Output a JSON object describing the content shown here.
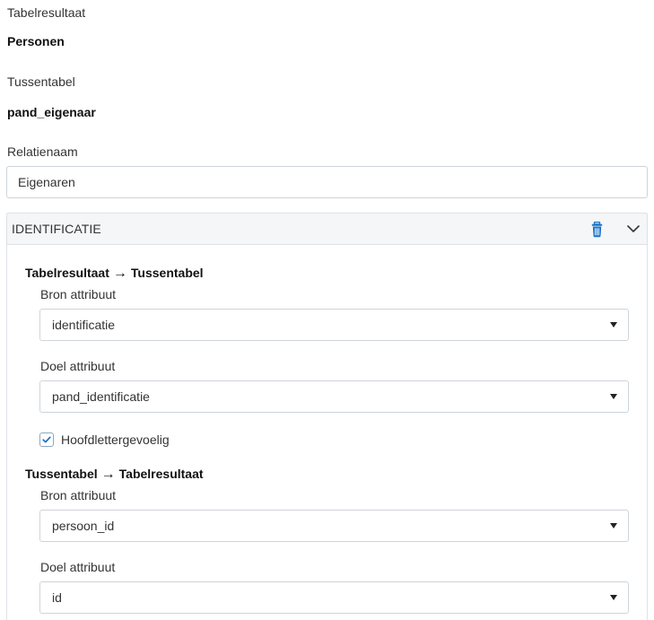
{
  "form": {
    "table_result_label": "Tabelresultaat",
    "table_result_value": "Personen",
    "junction_table_label": "Tussentabel",
    "junction_table_value": "pand_eigenaar",
    "relation_name_label": "Relatienaam",
    "relation_name_value": "Eigenaren"
  },
  "panel": {
    "title": "IDENTIFICATIE",
    "trash_icon": "trash-icon",
    "chevron_icon": "chevron-down-icon",
    "accent_color": "#1a73c8",
    "section1": {
      "from": "Tabelresultaat",
      "arrow": "→",
      "to": "Tussentabel",
      "source_label": "Bron attribuut",
      "source_value": "identificatie",
      "target_label": "Doel attribuut",
      "target_value": "pand_identificatie",
      "case_sensitive_label": "Hoofdlettergevoelig",
      "case_sensitive_checked": true
    },
    "section2": {
      "from": "Tussentabel",
      "arrow": "→",
      "to": "Tabelresultaat",
      "source_label": "Bron attribuut",
      "source_value": "persoon_id",
      "target_label": "Doel attribuut",
      "target_value": "id"
    }
  }
}
